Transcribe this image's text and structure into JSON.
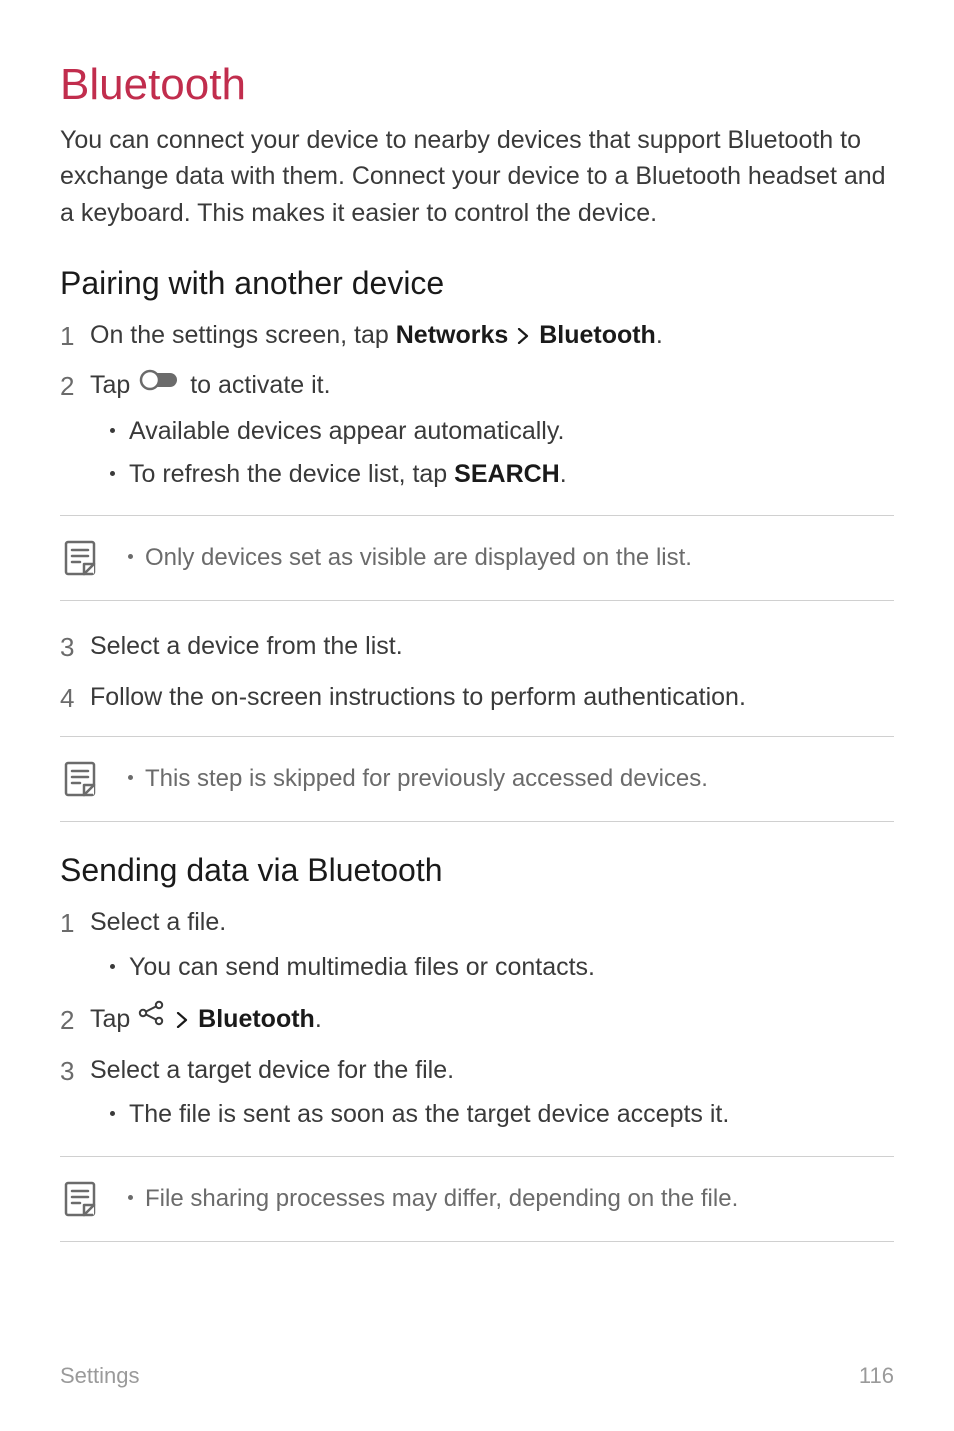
{
  "title": "Bluetooth",
  "intro": "You can connect your device to nearby devices that support Bluetooth to exchange data with them. Connect your device to a Bluetooth headset and a keyboard. This makes it easier to control the device.",
  "sectionA": {
    "heading": "Pairing with another device",
    "step1_pre": "On the settings screen, tap ",
    "step1_bold1": "Networks",
    "step1_bold2": "Bluetooth",
    "step1_period": ".",
    "step2_pre": "Tap ",
    "step2_post": " to activate it.",
    "step2_sub1": "Available devices appear automatically.",
    "step2_sub2_pre": "To refresh the device list, tap ",
    "step2_sub2_bold": "SEARCH",
    "step2_sub2_post": ".",
    "note1": "Only devices set as visible are displayed on the list.",
    "step3": "Select a device from the list.",
    "step4": "Follow the on-screen instructions to perform authentication.",
    "note2": "This step is skipped for previously accessed devices."
  },
  "sectionB": {
    "heading": "Sending data via Bluetooth",
    "step1": "Select a file.",
    "step1_sub1": "You can send multimedia files or contacts.",
    "step2_pre": "Tap ",
    "step2_bold": "Bluetooth",
    "step2_post": ".",
    "step3": "Select a target device for the file.",
    "step3_sub1": "The file is sent as soon as the target device accepts it.",
    "note1": "File sharing processes may differ, depending on the file."
  },
  "footer": {
    "section": "Settings",
    "page": "116"
  }
}
